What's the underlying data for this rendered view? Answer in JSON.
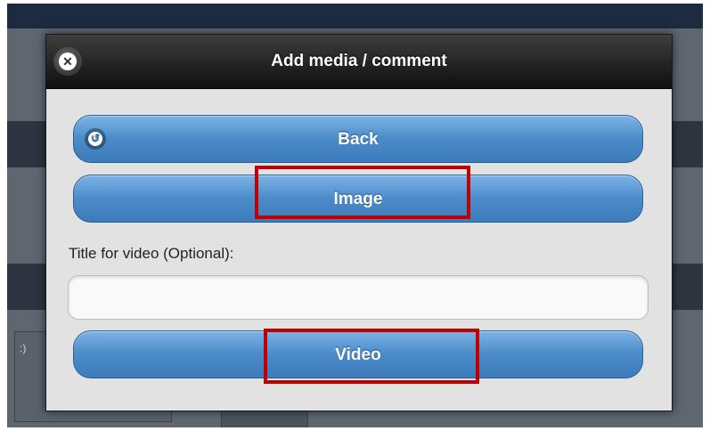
{
  "background": {
    "cell_text": ":)"
  },
  "dialog": {
    "title": "Add media / comment",
    "close_icon": "close-icon",
    "buttons": {
      "back_label": "Back",
      "back_icon": "back-arrow-icon",
      "image_label": "Image",
      "video_label": "Video"
    },
    "video_title_label": "Title for video (Optional):",
    "video_title_value": "",
    "video_title_placeholder": ""
  },
  "colors": {
    "button_blue": "#4b8bc9",
    "header_dark": "#1a1a1a",
    "highlight_red": "#c00000",
    "frame_blue": "#2f5f96"
  }
}
